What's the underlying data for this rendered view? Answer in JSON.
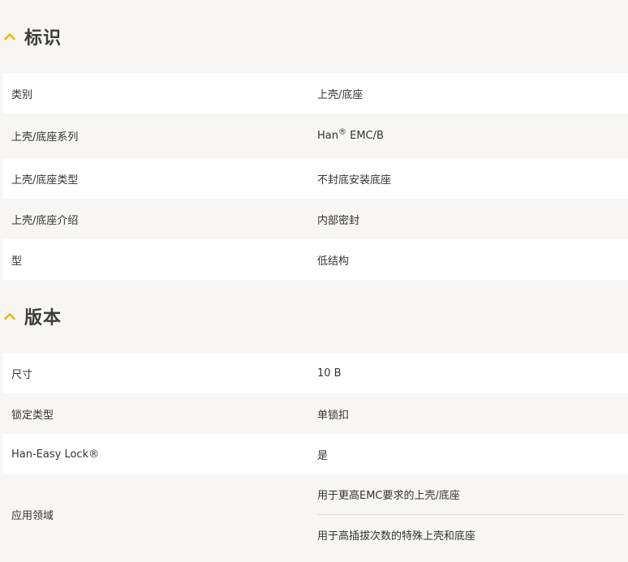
{
  "accent_color": "#f0b400",
  "sections": [
    {
      "title": "标识",
      "rows": [
        {
          "key": "类别",
          "value": "上壳/底座"
        },
        {
          "key": "上壳/底座系列",
          "value": "Han",
          "value_sup": "®",
          "value_suffix": " EMC/B"
        },
        {
          "key": "上壳/底座类型",
          "value": "不封底安装底座"
        },
        {
          "key": "上壳/底座介绍",
          "value": "内部密封"
        },
        {
          "key": "型",
          "value": "低结构"
        }
      ]
    },
    {
      "title": "版本",
      "rows": [
        {
          "key": "尺寸",
          "value": "10 B"
        },
        {
          "key": "锁定类型",
          "value": "单锁扣"
        },
        {
          "key": "Han-Easy Lock®",
          "value": "是"
        },
        {
          "key": "应用领域",
          "values": [
            "用于更高EMC要求的上壳/底座",
            "用于高插拔次数的特殊上壳和底座"
          ]
        }
      ]
    }
  ],
  "icons": {
    "section_toggle": "chevron-up-icon"
  }
}
